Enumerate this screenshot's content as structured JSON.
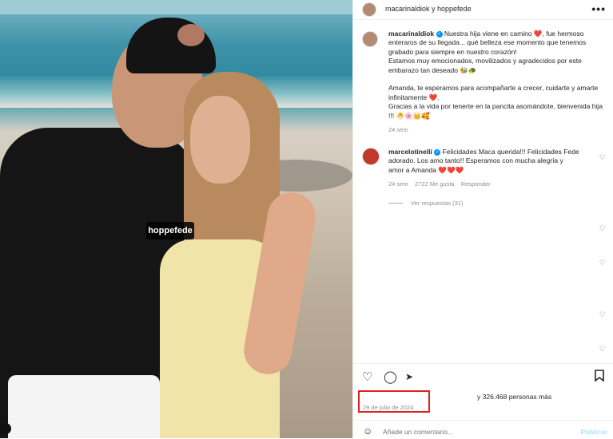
{
  "photo": {
    "tag_label": "hoppefede"
  },
  "header": {
    "title": "macarinaldiok y hoppefede",
    "more_label": "•••"
  },
  "caption": {
    "username": "macarinaldiok",
    "verified": "✓",
    "text_1": "Nuestra hija viene en camino ❤️, fue hermoso enteraros de su llegada... qué belleza ese momento que tenemos grabado para siempre en nuestro corazón!",
    "text_2": "Estamos muy emocionados, movilizados y agradecidos por este embarazo tan deseado 🐝🐢",
    "text_3": "Amanda, te esperamos para acompañarte a crecer, cuidarte y amarte infinitamente ❤️.",
    "text_4": "Gracias a la vida por tenerte en la pancita asomándote, bienvenida hija !!! 🐣🌸👑🥰",
    "time": "24 sem"
  },
  "comment": {
    "username": "marcelotinelli",
    "verified": "✓",
    "text": "Felicidades Maca querida!!! Felicidades Fede adorado. Los amo tanto!! Esperamos con mucha alegría y amor a Amanda ❤️❤️❤️",
    "time": "24 sem",
    "likes": "2722 Me gusta",
    "reply": "Responder",
    "view_replies": "Ver respuestas (31)"
  },
  "likes_text": "y 326.468 personas más",
  "date": "29 de julio de 2024",
  "add_comment": {
    "placeholder": "Añade un comentario...",
    "publish": "Publicar"
  },
  "icons": [
    "heart-icon",
    "comment-icon",
    "share-icon",
    "bookmark-icon",
    "emoji-icon"
  ],
  "colors": {
    "highlight": "#e0201e",
    "verified": "#0095f6"
  }
}
